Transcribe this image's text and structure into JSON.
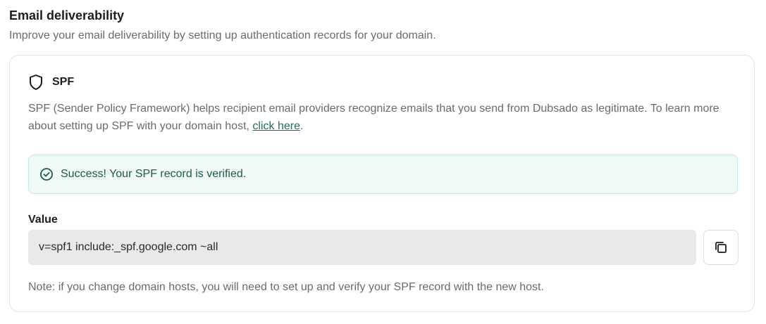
{
  "section": {
    "title": "Email deliverability",
    "subtitle": "Improve your email deliverability by setting up authentication records for your domain."
  },
  "spf": {
    "icon": "shield-icon",
    "title": "SPF",
    "description_before_link": "SPF (Sender Policy Framework) helps recipient email providers recognize emails that you send from Dubsado as legitimate. To learn more about setting up SPF with your domain host, ",
    "link_text": "click here",
    "description_after_link": ".",
    "alert": {
      "icon": "check-circle-icon",
      "text": "Success! Your SPF record is verified."
    },
    "value_label": "Value",
    "value": "v=spf1 include:_spf.google.com ~all",
    "copy_icon": "copy-icon",
    "note": "Note: if you change domain hosts, you will need to set up and verify your SPF record with the new host."
  },
  "colors": {
    "success_bg": "#eefaf3",
    "success_border": "#c2ecd4",
    "success_text": "#1f5a47",
    "link": "#1f6f5c",
    "field_bg": "#e9e9e9"
  }
}
